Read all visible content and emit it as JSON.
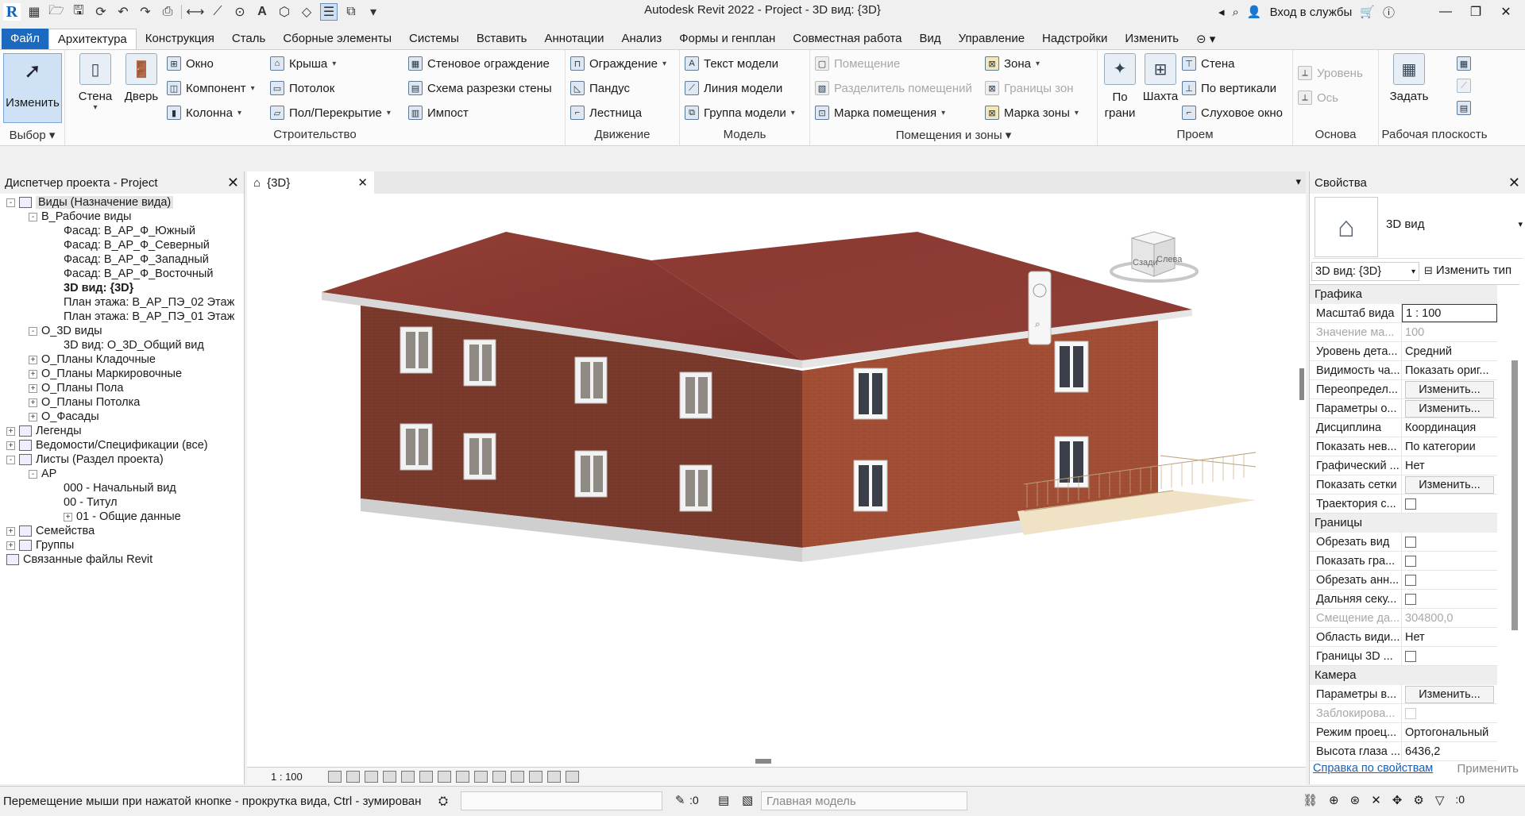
{
  "app": {
    "title": "Autodesk Revit 2022 - Project - 3D вид: {3D}"
  },
  "title_right": {
    "signin": "Вход в службы"
  },
  "menu": {
    "tabs": [
      "Файл",
      "Архитектура",
      "Конструкция",
      "Сталь",
      "Сборные элементы",
      "Системы",
      "Вставить",
      "Аннотации",
      "Анализ",
      "Формы и генплан",
      "Совместная работа",
      "Вид",
      "Управление",
      "Надстройки",
      "Изменить"
    ],
    "active": "Архитектура"
  },
  "ribbon": {
    "select": {
      "modify": "Изменить",
      "title": "Выбор"
    },
    "build": {
      "title": "Строительство",
      "wall": "Стена",
      "door": "Дверь",
      "window": "Окно",
      "component": "Компонент",
      "column": "Колонна",
      "roof": "Крыша",
      "ceiling": "Потолок",
      "floor": "Пол/Перекрытие",
      "curtain_system": "Стеновое ограждение",
      "curtain_grid": "Схема разрезки стены",
      "mullion": "Импост"
    },
    "circulation": {
      "title": "Движение",
      "railing": "Ограждение",
      "ramp": "Пандус",
      "stair": "Лестница"
    },
    "model": {
      "title": "Модель",
      "model_text": "Текст модели",
      "model_line": "Линия модели",
      "model_group": "Группа модели"
    },
    "room": {
      "title": "Помещения и зоны",
      "room": "Помещение",
      "room_sep": "Разделитель помещений",
      "room_tag": "Марка помещения",
      "area": "Зона",
      "area_boundary": "Границы зон",
      "area_tag": "Марка зоны"
    },
    "opening": {
      "title": "Проем",
      "by_face": "По",
      "by_face2": "грани",
      "shaft": "Шахта",
      "wall": "Стена",
      "vertical": "По вертикали",
      "dormer": "Слуховое окно"
    },
    "datum": {
      "title": "Основа",
      "level": "Уровень",
      "grid": "Ось"
    },
    "workplane": {
      "title": "Рабочая плоскость",
      "set": "Задать"
    }
  },
  "browser": {
    "title": "Диспетчер проекта - Project",
    "nodes": [
      {
        "label": "Виды (Назначение вида)",
        "level": 0,
        "exp": "-",
        "sel": true
      },
      {
        "label": "В_Рабочие виды",
        "level": 1,
        "exp": "-"
      },
      {
        "label": "Фасад: В_АР_Ф_Южный",
        "level": 2
      },
      {
        "label": "Фасад: В_АР_Ф_Северный",
        "level": 2
      },
      {
        "label": "Фасад: В_АР_Ф_Западный",
        "level": 2
      },
      {
        "label": "Фасад: В_АР_Ф_Восточный",
        "level": 2
      },
      {
        "label": "3D вид: {3D}",
        "level": 2,
        "bold": true
      },
      {
        "label": "План этажа: В_АР_ПЭ_02 Этаж",
        "level": 2
      },
      {
        "label": "План этажа: В_АР_ПЭ_01 Этаж",
        "level": 2
      },
      {
        "label": "О_3D виды",
        "level": 1,
        "exp": "-"
      },
      {
        "label": "3D вид: О_3D_Общий вид",
        "level": 2
      },
      {
        "label": "О_Планы Кладочные",
        "level": 1,
        "exp": "+"
      },
      {
        "label": "О_Планы Маркировочные",
        "level": 1,
        "exp": "+"
      },
      {
        "label": "О_Планы Пола",
        "level": 1,
        "exp": "+"
      },
      {
        "label": "О_Планы Потолка",
        "level": 1,
        "exp": "+"
      },
      {
        "label": "О_Фасады",
        "level": 1,
        "exp": "+"
      },
      {
        "label": "Легенды",
        "level": 0,
        "exp": "+"
      },
      {
        "label": "Ведомости/Спецификации (все)",
        "level": 0,
        "exp": "+"
      },
      {
        "label": "Листы (Раздел проекта)",
        "level": 0,
        "exp": "-"
      },
      {
        "label": "АР",
        "level": 1,
        "exp": "-"
      },
      {
        "label": "000 - Начальный вид",
        "level": 2
      },
      {
        "label": "00 - Титул",
        "level": 2
      },
      {
        "label": "01 - Общие данные",
        "level": 2,
        "exp": "+"
      },
      {
        "label": "Семейства",
        "level": 0,
        "exp": "+"
      },
      {
        "label": "Группы",
        "level": 0,
        "exp": "+"
      },
      {
        "label": "Связанные файлы Revit",
        "level": 0
      }
    ]
  },
  "view": {
    "tab": "{3D}",
    "scale": "1 : 100",
    "cube_left": "Сзади",
    "cube_right": "Слева"
  },
  "props": {
    "title": "Свойства",
    "type_name": "3D вид",
    "selector": "3D вид: {3D}",
    "edit_type": "Изменить тип",
    "groups": {
      "graphics": "Графика",
      "extents": "Границы",
      "camera": "Камера"
    },
    "graphics": [
      {
        "name": "Масштаб вида",
        "value": "1 : 100",
        "kind": "input"
      },
      {
        "name": "Значение ма...",
        "value": "100",
        "kind": "dis"
      },
      {
        "name": "Уровень дета...",
        "value": "Средний"
      },
      {
        "name": "Видимость ча...",
        "value": "Показать ориг..."
      },
      {
        "name": "Переопредел...",
        "value": "Изменить...",
        "kind": "btn"
      },
      {
        "name": "Параметры о...",
        "value": "Изменить...",
        "kind": "btn"
      },
      {
        "name": "Дисциплина",
        "value": "Координация"
      },
      {
        "name": "Показать нев...",
        "value": "По категории"
      },
      {
        "name": "Графический ...",
        "value": "Нет"
      },
      {
        "name": "Показать сетки",
        "value": "Изменить...",
        "kind": "btn"
      },
      {
        "name": "Траектория с...",
        "value": "",
        "kind": "cb"
      }
    ],
    "extents": [
      {
        "name": "Обрезать вид",
        "value": "",
        "kind": "cb"
      },
      {
        "name": "Показать гра...",
        "value": "",
        "kind": "cb"
      },
      {
        "name": "Обрезать анн...",
        "value": "",
        "kind": "cb"
      },
      {
        "name": "Дальняя секу...",
        "value": "",
        "kind": "cb"
      },
      {
        "name": "Смещение да...",
        "value": "304800,0",
        "kind": "dis"
      },
      {
        "name": "Область види...",
        "value": "Нет"
      },
      {
        "name": "Границы 3D ...",
        "value": "",
        "kind": "cb"
      }
    ],
    "camera": [
      {
        "name": "Параметры в...",
        "value": "Изменить...",
        "kind": "btn"
      },
      {
        "name": "Заблокирова...",
        "value": "",
        "kind": "cbdis"
      },
      {
        "name": "Режим проец...",
        "value": "Ортогональный"
      },
      {
        "name": "Высота глаза ...",
        "value": "6436,2"
      }
    ],
    "help": "Справка по свойствам",
    "apply": "Применить"
  },
  "status": {
    "message": "Перемещение мыши при нажатой кнопке - прокрутка вида, Ctrl - зумирован",
    "workset_count": ":0",
    "model": "Главная модель",
    "filter_count": ":0"
  },
  "colors": {
    "accent": "#1b6ac0",
    "roof": "#8a3530",
    "brick": "#8e3f2f"
  }
}
